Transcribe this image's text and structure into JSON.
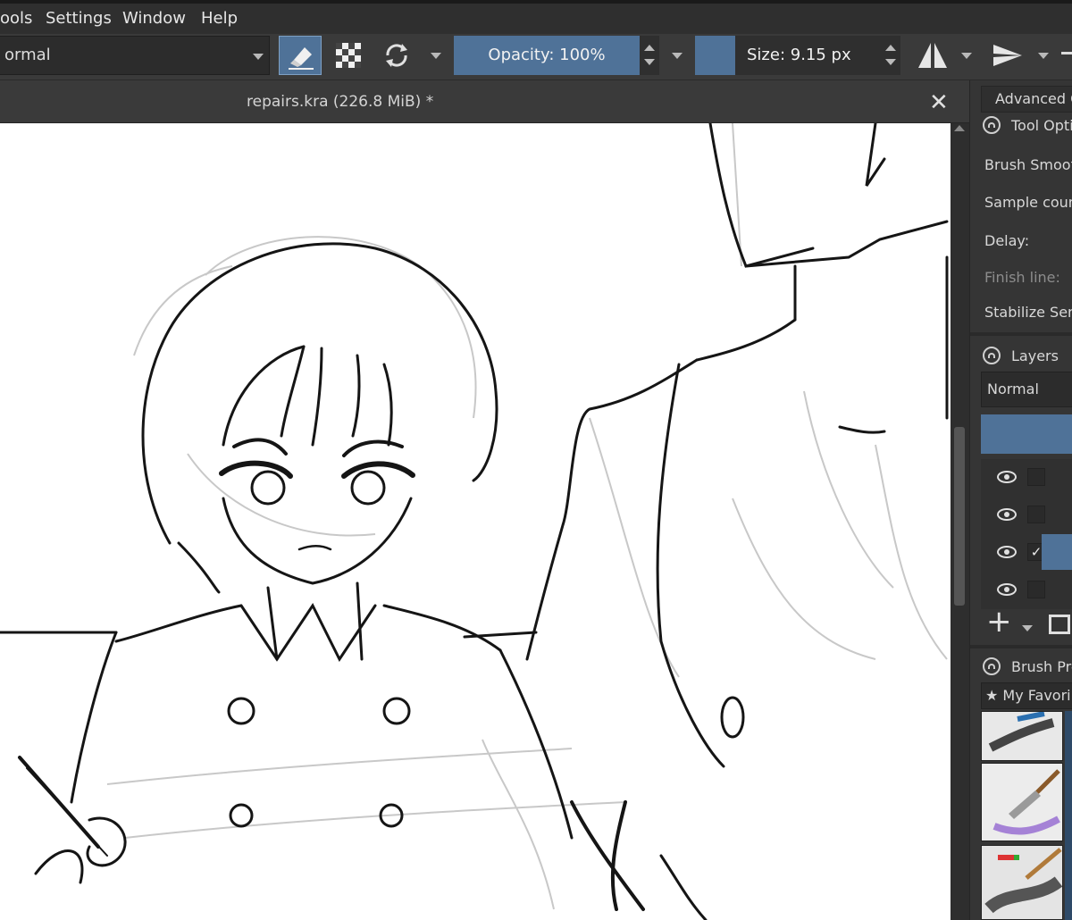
{
  "menubar": {
    "items": [
      "ools",
      "Settings",
      "Window",
      "Help"
    ]
  },
  "toolbar": {
    "blend_mode": "ormal",
    "opacity_label": "Opacity: 100%",
    "size_label": "Size: 9.15 px",
    "accent_color": "#4f7298"
  },
  "document": {
    "tab_title": "repairs.kra (226.8 MiB) *",
    "close_glyph": "✕"
  },
  "dock": {
    "advanced_label": "Advanced C",
    "tool_options": {
      "title": "Tool Opti",
      "brush_smoothing": "Brush Smoot",
      "sample_count": "Sample coun",
      "delay": "Delay:",
      "finish_line": "Finish line:",
      "stabilize_sensors": "Stabilize Sen"
    },
    "layers": {
      "title": "Layers",
      "blend_mode": "Normal",
      "checkmark": "✓",
      "add_glyph": "+"
    },
    "brush_presets": {
      "title": "Brush Pre",
      "tag": "★ My Favori"
    }
  }
}
